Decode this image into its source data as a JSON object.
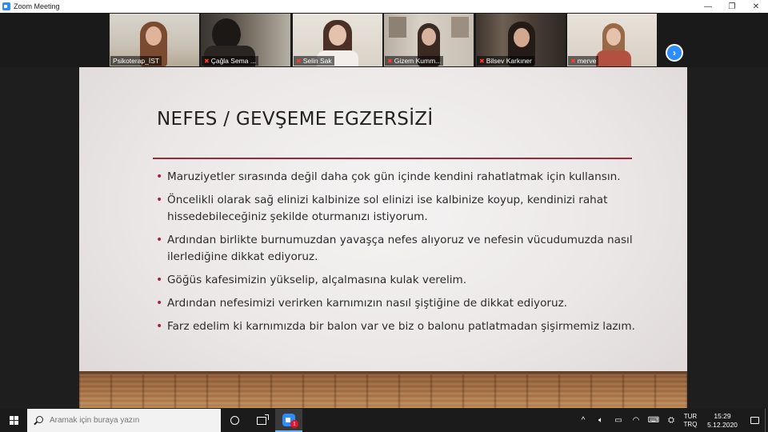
{
  "window": {
    "title": "Zoom Meeting",
    "controls": {
      "minimize": "—",
      "restore": "❐",
      "close": "✕"
    }
  },
  "participants": [
    {
      "name": "Psikoterap_İST",
      "muted": false,
      "active": true
    },
    {
      "name": "Çağla Sema ...",
      "muted": true,
      "active": false
    },
    {
      "name": "Selin Sak",
      "muted": true,
      "active": false
    },
    {
      "name": "Gizem Kumm...",
      "muted": true,
      "active": false
    },
    {
      "name": "Bilsev Karkıner",
      "muted": true,
      "active": false
    },
    {
      "name": "merve",
      "muted": true,
      "active": false
    }
  ],
  "strip_next_icon": "chevron-right-icon",
  "slide": {
    "title": "NEFES / GEVŞEME EGZERSİZİ",
    "accent_color": "#a3263c",
    "bullets": [
      "Maruziyetler sırasında değil daha çok gün içinde kendini rahatlatmak için kullansın.",
      "Öncelikli olarak sağ elinizi kalbinize sol elinizi ise kalbinize koyup, kendinizi rahat hissedebileceğiniz şekilde oturmanızı istiyorum.",
      "Ardından birlikte burnumuzdan yavaşça nefes alıyoruz ve nefesin vücudumuzda nasıl ilerlediğine dikkat ediyoruz.",
      "Göğüs kafesimizin yükselip, alçalmasına kulak verelim.",
      "Ardından nefesimizi verirken karnımızın nasıl şiştiğine de dikkat ediyoruz.",
      "Farz edelim ki karnımızda bir balon var ve biz o balonu patlatmadan şişirmemiz lazım."
    ]
  },
  "taskbar": {
    "search_placeholder": "Aramak için buraya yazın",
    "zoom_badge": "1",
    "tray_chevron": "^",
    "lang_top": "TUR",
    "lang_bottom": "TRQ",
    "time": "15:29",
    "date": "5.12.2020"
  }
}
